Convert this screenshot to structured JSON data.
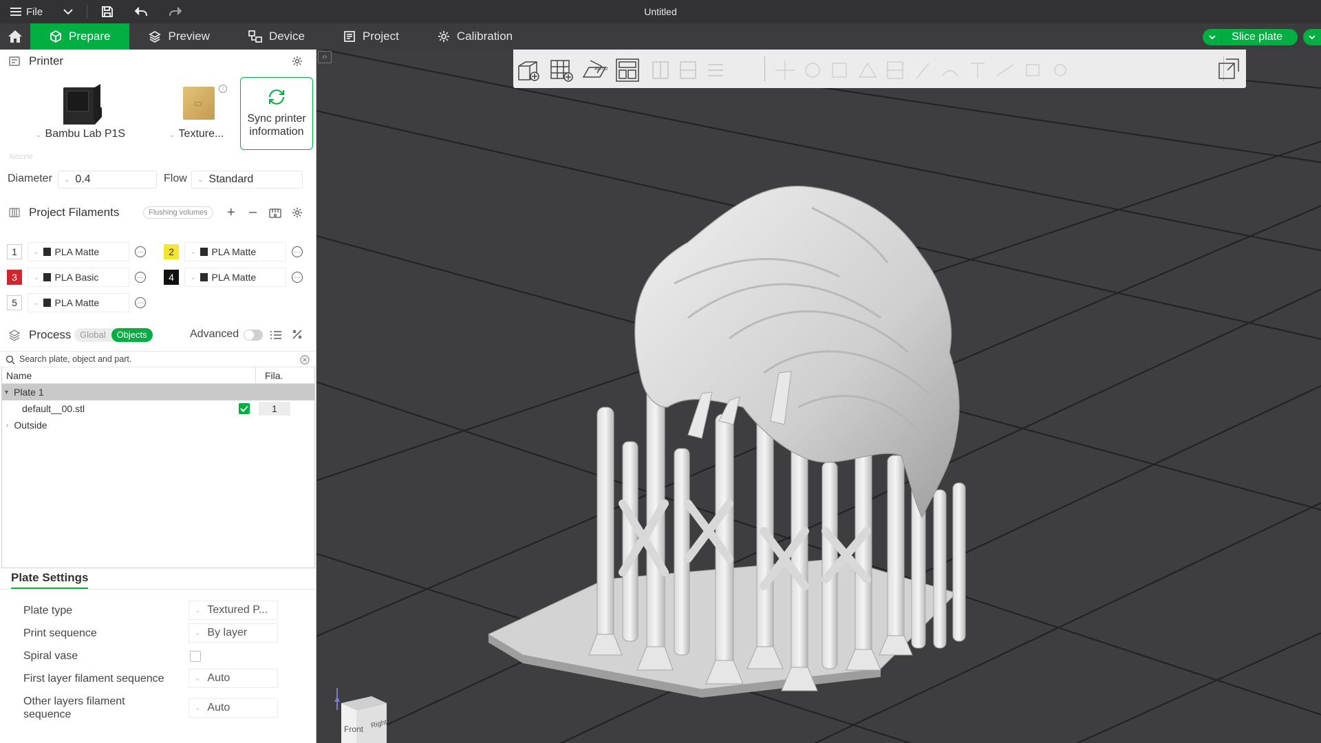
{
  "titlebar": {
    "file_label": "File",
    "title": "Untitled"
  },
  "tabs": {
    "prepare": "Prepare",
    "preview": "Preview",
    "device": "Device",
    "project": "Project",
    "calibration": "Calibration"
  },
  "slice_button": "Slice plate",
  "printer": {
    "section_title": "Printer",
    "printer_name": "Bambu Lab P1S",
    "plate_name": "Texture...",
    "sync_label_1": "Sync printer",
    "sync_label_2": "information",
    "nozzle_hint": "Nozzle",
    "diameter_label": "Diameter",
    "diameter_value": "0.4",
    "flow_label": "Flow",
    "flow_value": "Standard"
  },
  "filaments": {
    "section_title": "Project Filaments",
    "flushing_label": "Flushing volumes",
    "items": [
      {
        "num": "1",
        "name": "PLA Matte",
        "color": "#ffffff",
        "text_color": "#333333"
      },
      {
        "num": "2",
        "name": "PLA Matte",
        "color": "#f5e531",
        "text_color": "#333333"
      },
      {
        "num": "3",
        "name": "PLA Basic",
        "color": "#d1262e",
        "text_color": "#ffffff"
      },
      {
        "num": "4",
        "name": "PLA Matte",
        "color": "#111111",
        "text_color": "#ffffff"
      },
      {
        "num": "5",
        "name": "PLA Matte",
        "color": "#ffffff",
        "text_color": "#333333"
      }
    ]
  },
  "process": {
    "section_title": "Process",
    "global_label": "Global",
    "objects_label": "Objects",
    "advanced_label": "Advanced",
    "search_placeholder": "Search plate, object and part.",
    "col_name": "Name",
    "col_fila": "Fila.",
    "plate_row": "Plate 1",
    "object_row": "default__00.stl",
    "object_filament": "1",
    "outside_row": "Outside"
  },
  "plate_settings": {
    "tab_label": "Plate Settings",
    "plate_type_label": "Plate type",
    "plate_type_value": "Textured P...",
    "print_sequence_label": "Print sequence",
    "print_sequence_value": "By layer",
    "spiral_vase_label": "Spiral vase",
    "first_layer_label": "First layer filament sequence",
    "first_layer_value": "Auto",
    "other_layers_label_1": "Other layers filament",
    "other_layers_label_2": "sequence",
    "other_layers_value": "Auto"
  },
  "viewport": {
    "cube_front": "Front",
    "cube_right": "Right",
    "axis_z": "Z"
  },
  "colors": {
    "accent": "#00ae42",
    "viewport_bg": "#3e3e40",
    "titlebar_bg": "#323234"
  }
}
